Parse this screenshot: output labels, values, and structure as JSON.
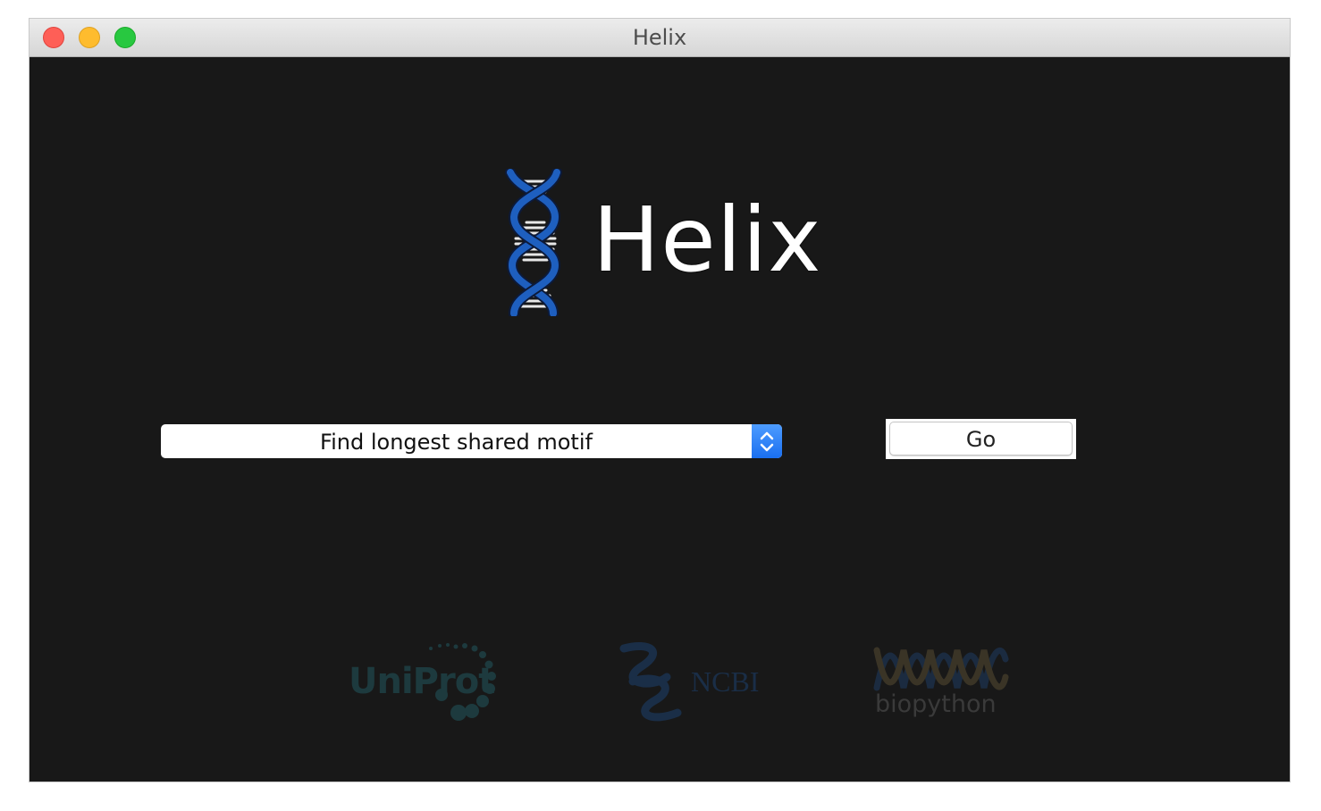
{
  "window": {
    "title": "Helix"
  },
  "logo": {
    "text": "Helix",
    "icon": "dna-helix-icon",
    "accent_color": "#1e5fbf"
  },
  "task_select": {
    "selected": "Find longest shared motif"
  },
  "go_button": {
    "label": "Go"
  },
  "partners": {
    "uniprot": "UniProt",
    "ncbi": "NCBI",
    "biopython": "biopython"
  },
  "colors": {
    "background": "#181818",
    "select_stepper": "#2a7bf5"
  }
}
